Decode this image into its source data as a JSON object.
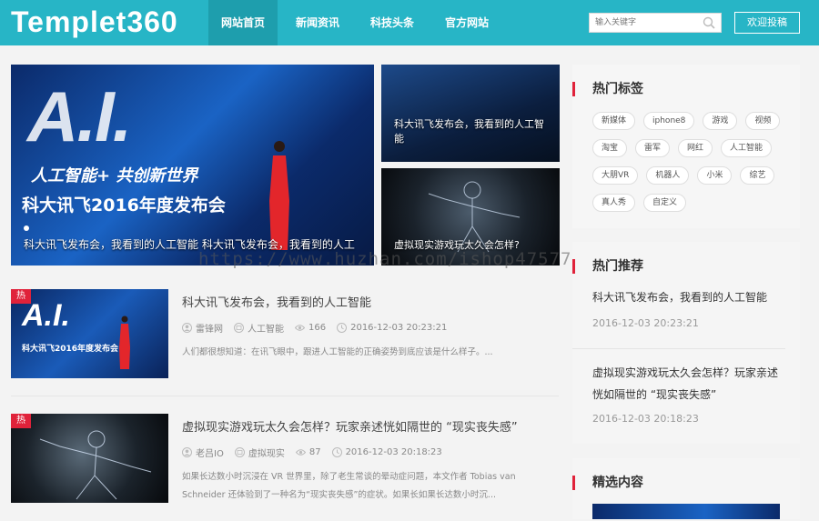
{
  "header": {
    "logo": "Templet360",
    "nav": [
      {
        "label": "网站首页",
        "active": true
      },
      {
        "label": "新闻资讯",
        "active": false
      },
      {
        "label": "科技头条",
        "active": false
      },
      {
        "label": "官方网站",
        "active": false
      }
    ],
    "search_placeholder": "输入关键字",
    "submit_label": "欢迎投稿",
    "brand_color": "#27b5c6"
  },
  "hero": {
    "main": {
      "caption": "科大讯飞发布会，我看到的人工智能 科大讯飞发布会，我看到的人工",
      "image_text": "A.I.",
      "image_subtitle": "人工智能+ 共创新世界",
      "image_year_text": "科大讯飞2016年度发布会"
    },
    "small1": {
      "caption": "科大讯飞发布会，我看到的人工智能"
    },
    "small2": {
      "caption": "虚拟现实游戏玩太久会怎样?"
    }
  },
  "watermark": "https://www.huzhan.com/ishop47577",
  "articles": [
    {
      "badge": "热",
      "title": "科大讯飞发布会，我看到的人工智能",
      "author": "雷锋网",
      "category": "人工智能",
      "views": "166",
      "date": "2016-12-03 20:23:21",
      "desc": "人们都很想知道：在讯飞眼中，跟进人工智能的正确姿势到底应该是什么样子。...",
      "thumb_title": "A.I.",
      "thumb_sub": "科大讯飞2016年度发布会"
    },
    {
      "badge": "热",
      "title": "虚拟现实游戏玩太久会怎样？玩家亲述恍如隔世的 “现实丧失感”",
      "author": "老吕IO",
      "category": "虚拟现实",
      "views": "87",
      "date": "2016-12-03 20:18:23",
      "desc": "如果长达数小时沉浸在 VR 世界里，除了老生常谈的晕动症问题，本文作者 Tobias van Schneider 还体验到了一种名为“现实丧失感”的症状。如果长如果长达数小时沉..."
    }
  ],
  "sidebar": {
    "tags_title": "热门标签",
    "tags": [
      "新媒体",
      "iphone8",
      "游戏",
      "视频",
      "淘宝",
      "雷军",
      "网红",
      "人工智能",
      "大朋VR",
      "机器人",
      "小米",
      "综艺",
      "真人秀",
      "自定义"
    ],
    "recommend_title": "热门推荐",
    "recommend": [
      {
        "title": "科大讯飞发布会，我看到的人工智能",
        "date": "2016-12-03 20:23:21"
      },
      {
        "title": "虚拟现实游戏玩太久会怎样？玩家亲述恍如隔世的 “现实丧失感”",
        "date": "2016-12-03 20:18:23"
      }
    ],
    "selected_title": "精选内容"
  },
  "accent_color": "#e0223a"
}
